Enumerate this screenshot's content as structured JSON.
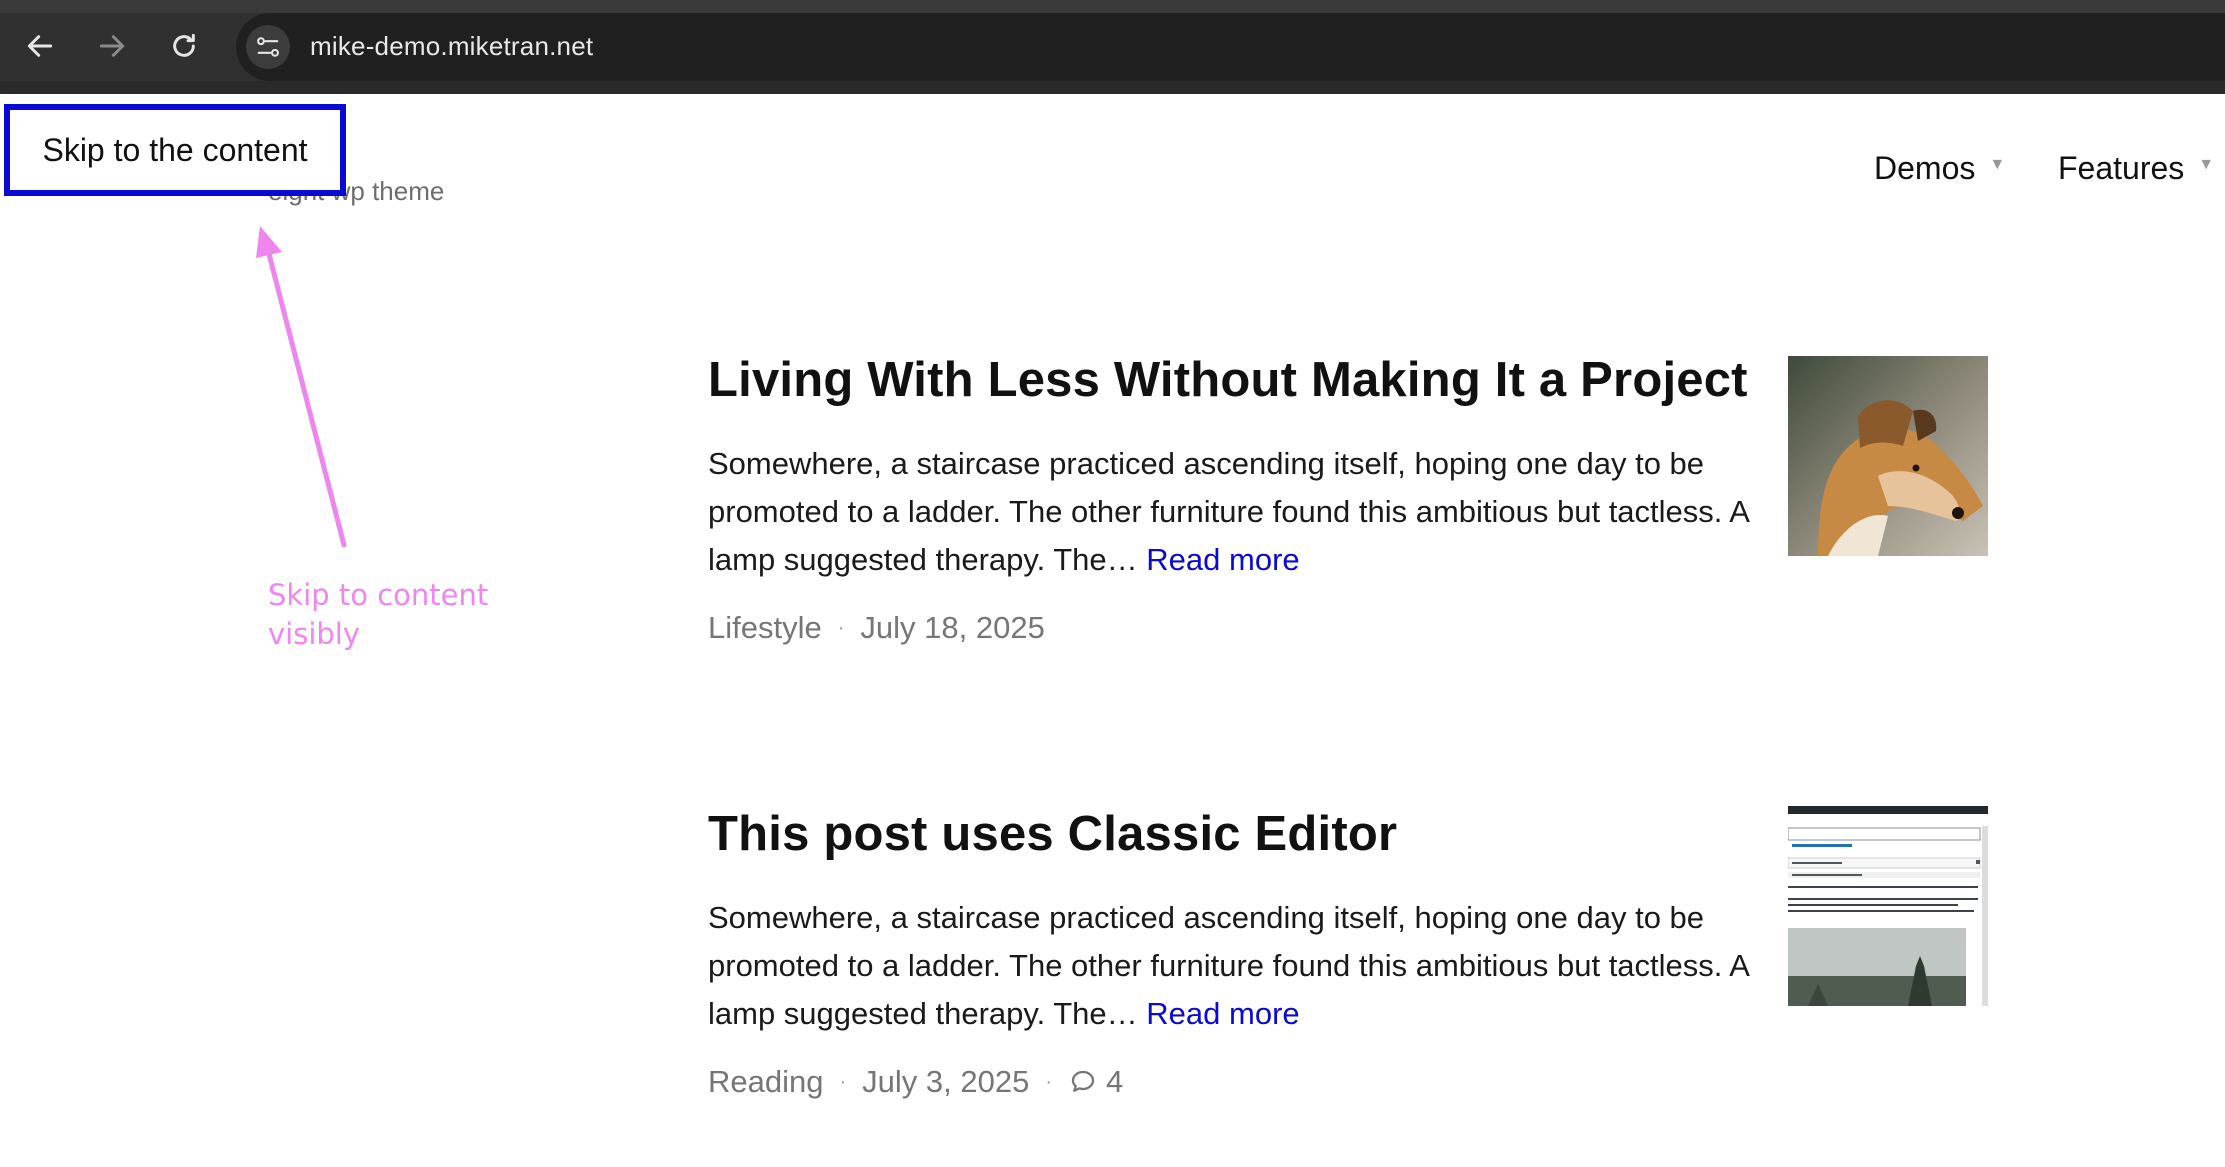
{
  "browser": {
    "url": "mike-demo.miketran.net",
    "icons": [
      "back-icon",
      "forward-icon",
      "reload-icon",
      "site-info-icon"
    ]
  },
  "site": {
    "tagline": "eight wp theme",
    "skip_link": "Skip to the content",
    "menu": [
      {
        "label": "Demos"
      },
      {
        "label": "Features"
      }
    ]
  },
  "annotation": {
    "text": "Skip to content visibly",
    "color": "#ef86ef"
  },
  "posts": [
    {
      "title": "Living With Less Without Making It a Project",
      "excerpt": "Somewhere, a staircase practiced ascending itself, hoping one day to be promoted to a ladder. The other furniture found this ambitious but tactless. A lamp suggested therapy. The…",
      "read_more": "Read more",
      "category": "Lifestyle",
      "date": "July 18, 2025"
    },
    {
      "title": "This post uses Classic Editor",
      "excerpt": "Somewhere, a staircase practiced ascending itself, hoping one day to be promoted to a ladder. The other furniture found this ambitious but tactless. A lamp suggested therapy. The…",
      "read_more": "Read more",
      "category": "Reading",
      "date": "July 3, 2025",
      "comments": "4"
    }
  ],
  "colors": {
    "link": "#0a0ad2",
    "focus_outline": "#0a0ad2",
    "meta": "#767676"
  }
}
